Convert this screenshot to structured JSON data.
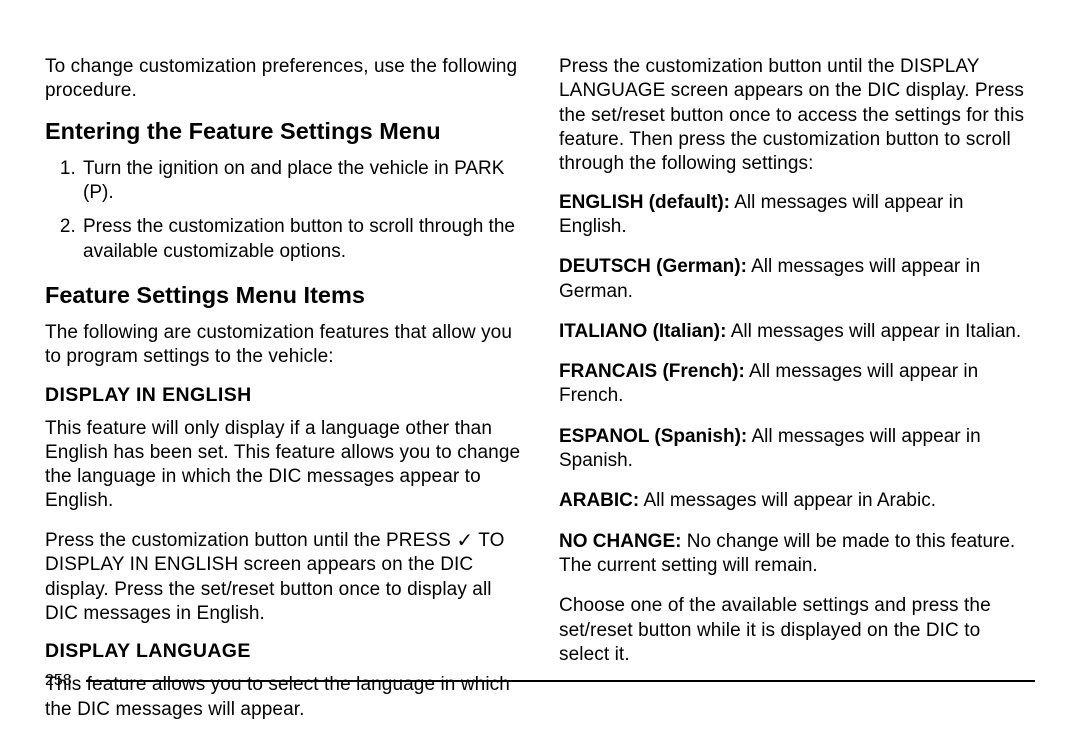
{
  "left": {
    "intro": "To change customization preferences, use the following procedure.",
    "heading1": "Entering the Feature Settings Menu",
    "steps": [
      "Turn the ignition on and place the vehicle in PARK (P).",
      "Press the customization button to scroll through the available customizable options."
    ],
    "heading2": "Feature Settings Menu Items",
    "heading2_intro": "The following are customization features that allow you to program settings to the vehicle:",
    "sub1": "DISPLAY IN ENGLISH",
    "sub1_p1": "This feature will only display if a language other than English has been set. This feature allows you to change the language in which the DIC messages appear to English.",
    "sub1_p2_pre": "Press the customization button until the PRESS ",
    "sub1_p2_post": " TO DISPLAY IN ENGLISH screen appears on the DIC display. Press the set/reset button once to display all DIC messages in English.",
    "checkmark": "✓",
    "sub2": "DISPLAY LANGUAGE",
    "sub2_p1": "This feature allows you to select the language in which the DIC messages will appear."
  },
  "right": {
    "intro": "Press the customization button until the DISPLAY LANGUAGE screen appears on the DIC display. Press the set/reset button once to access the settings for this feature. Then press the customization button to scroll through the following settings:",
    "options": [
      {
        "label": "ENGLISH (default):",
        "text": "  All messages will appear in English."
      },
      {
        "label": "DEUTSCH (German):",
        "text": "  All messages will appear in German."
      },
      {
        "label": "ITALIANO (Italian):",
        "text": "  All messages will appear in Italian."
      },
      {
        "label": "FRANCAIS (French):",
        "text": "  All messages will appear in French."
      },
      {
        "label": "ESPANOL (Spanish):",
        "text": "  All messages will appear in Spanish."
      },
      {
        "label": "ARABIC:",
        "text": "  All messages will appear in Arabic."
      },
      {
        "label": "NO CHANGE:",
        "text": "  No change will be made to this feature. The current setting will remain."
      }
    ],
    "closing": "Choose one of the available settings and press the set/reset button while it is displayed on the DIC to select it."
  },
  "page_number": "258"
}
